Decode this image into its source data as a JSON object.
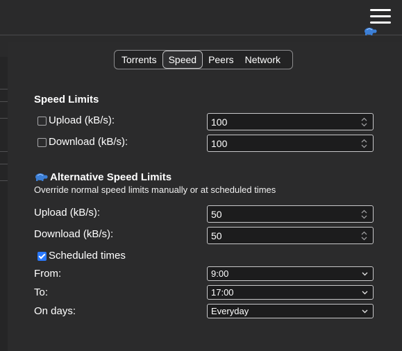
{
  "tabs": [
    {
      "label": "Torrents",
      "active": false
    },
    {
      "label": "Speed",
      "active": true
    },
    {
      "label": "Peers",
      "active": false
    },
    {
      "label": "Network",
      "active": false
    }
  ],
  "speed_limits": {
    "title": "Speed Limits",
    "upload": {
      "label": "Upload (kB/s):",
      "checked": false,
      "value": "100"
    },
    "download": {
      "label": "Download (kB/s):",
      "checked": false,
      "value": "100"
    }
  },
  "alt_speed_limits": {
    "title": "Alternative Speed Limits",
    "subtitle": "Override normal speed limits manually or at scheduled times",
    "upload": {
      "label": "Upload (kB/s):",
      "value": "50"
    },
    "download": {
      "label": "Download (kB/s):",
      "value": "50"
    },
    "scheduled": {
      "label": "Scheduled times",
      "checked": true
    },
    "from": {
      "label": "From:",
      "value": "9:00"
    },
    "to": {
      "label": "To:",
      "value": "17:00"
    },
    "days": {
      "label": "On days:",
      "value": "Everyday"
    }
  },
  "icons": {
    "menu": "hamburger-menu-icon",
    "turtle": "turtle-icon",
    "accent_color": "#2a79ff"
  }
}
